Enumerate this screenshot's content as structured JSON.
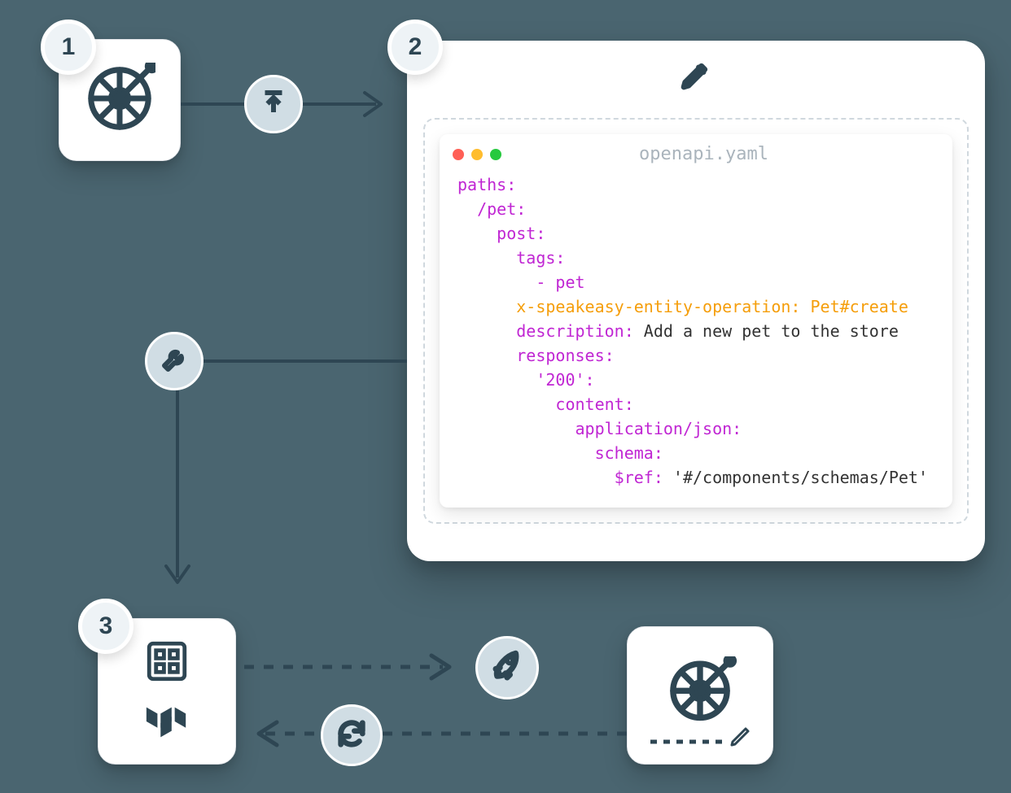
{
  "steps": {
    "one": "1",
    "two": "2",
    "three": "3"
  },
  "code": {
    "filename": "openapi.yaml",
    "lines": [
      {
        "k": "paths:",
        "indent": 0,
        "cls": "k"
      },
      {
        "k": "/pet:",
        "indent": 1,
        "cls": "k"
      },
      {
        "k": "post:",
        "indent": 2,
        "cls": "k"
      },
      {
        "k": "tags:",
        "indent": 3,
        "cls": "k"
      },
      {
        "k": "- pet",
        "indent": 4,
        "cls": "k"
      },
      {
        "k": "x-speakeasy-entity-operation: Pet#create",
        "indent": 3,
        "cls": "s"
      },
      {
        "k": "description:",
        "rest": " Add a new pet to the store",
        "indent": 3,
        "cls": "k"
      },
      {
        "k": "responses:",
        "indent": 3,
        "cls": "k"
      },
      {
        "k": "'200':",
        "indent": 4,
        "cls": "k"
      },
      {
        "k": "content:",
        "indent": 5,
        "cls": "k"
      },
      {
        "k": "application/json:",
        "indent": 6,
        "cls": "k"
      },
      {
        "k": "schema:",
        "indent": 7,
        "cls": "k"
      },
      {
        "k": "$ref:",
        "rest": " '#/components/schemas/Pet'",
        "indent": 8,
        "cls": "k"
      }
    ]
  },
  "icons": {
    "upload": "upload",
    "wrench": "wrench",
    "pencil": "pencil",
    "rocket": "rocket",
    "refresh": "refresh",
    "wheel": "speakeasy",
    "terraform": "terraform",
    "registry": "registry"
  }
}
